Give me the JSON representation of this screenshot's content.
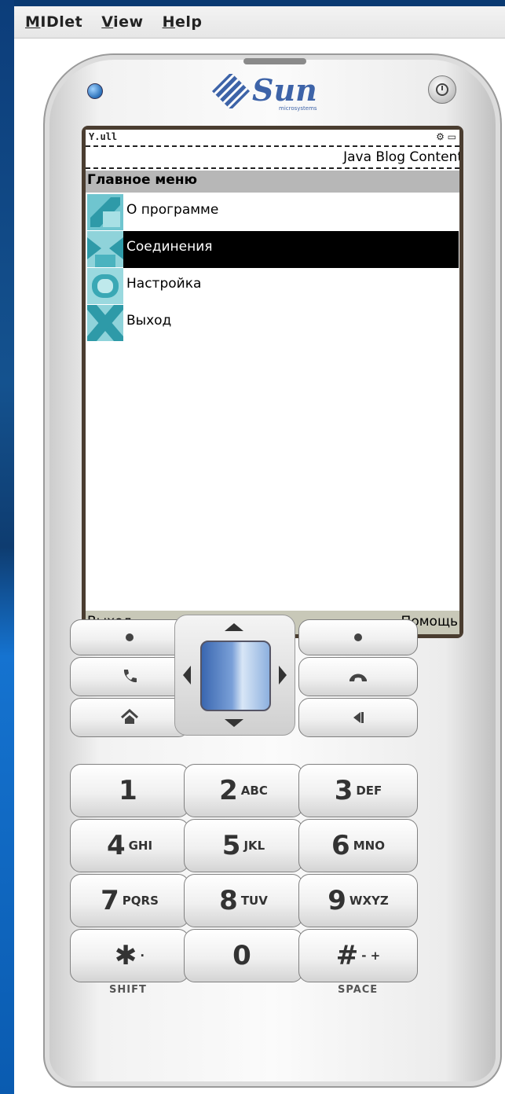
{
  "menubar": {
    "items": [
      "MIDlet",
      "View",
      "Help"
    ]
  },
  "phone": {
    "brand": "Sun",
    "brand_sub": "microsystems",
    "status": {
      "signal": "Y.ull",
      "icons": "⚙ ▭"
    },
    "ticker": "Java Blog Content",
    "title": "Главное меню",
    "menu_items": [
      {
        "label": "О программе",
        "icon": "about-icon",
        "selected": false
      },
      {
        "label": "Соединения",
        "icon": "connections-icon",
        "selected": true
      },
      {
        "label": "Настройка",
        "icon": "settings-icon",
        "selected": false
      },
      {
        "label": "Выход",
        "icon": "exit-icon",
        "selected": false
      }
    ],
    "softkeys": {
      "left": "Выход",
      "right": "Помощь"
    }
  },
  "keypad": {
    "shift_label": "SHIFT",
    "space_label": "SPACE",
    "keys": [
      {
        "digit": "1",
        "letters": ""
      },
      {
        "digit": "2",
        "letters": "ABC"
      },
      {
        "digit": "3",
        "letters": "DEF"
      },
      {
        "digit": "4",
        "letters": "GHI"
      },
      {
        "digit": "5",
        "letters": "JKL"
      },
      {
        "digit": "6",
        "letters": "MNO"
      },
      {
        "digit": "7",
        "letters": "PQRS"
      },
      {
        "digit": "8",
        "letters": "TUV"
      },
      {
        "digit": "9",
        "letters": "WXYZ"
      },
      {
        "digit": "✱",
        "letters": "·"
      },
      {
        "digit": "0",
        "letters": ""
      },
      {
        "digit": "#",
        "letters": "- +"
      }
    ]
  },
  "colors": {
    "accent": "#3d63a8",
    "selection": "#000000",
    "titlebar": "#b7b7b7",
    "softkeys": "#c8c8b8"
  }
}
